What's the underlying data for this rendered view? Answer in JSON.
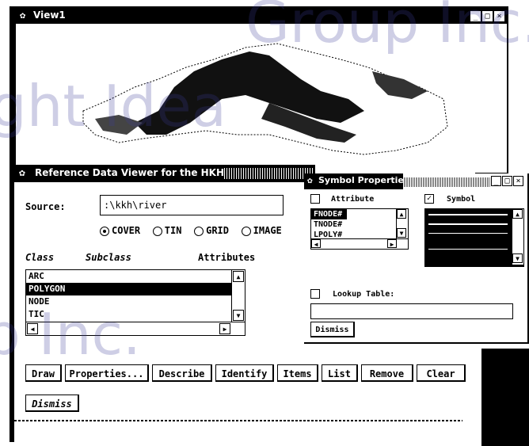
{
  "view_window": {
    "title": "View1",
    "minimize": "_",
    "maximize": "□",
    "close": "×"
  },
  "rdv": {
    "title": "Reference Data Viewer for the HKH",
    "source_label": "Source:",
    "source_value": ":\\kkh\\river",
    "radios": [
      {
        "label": "COVER",
        "selected": true
      },
      {
        "label": "TIN",
        "selected": false
      },
      {
        "label": "GRID",
        "selected": false
      },
      {
        "label": "IMAGE",
        "selected": false
      }
    ],
    "class_label": "Class",
    "subclass_label": "Subclass",
    "attributes_label": "Attributes",
    "class_items": [
      {
        "label": "ARC",
        "selected": false
      },
      {
        "label": "POLYGON",
        "selected": true
      },
      {
        "label": "NODE",
        "selected": false
      },
      {
        "label": "TIC",
        "selected": false
      }
    ],
    "buttons": [
      "Draw",
      "Properties...",
      "Describe",
      "Identify",
      "Items",
      "List",
      "Remove",
      "Clear"
    ],
    "dismiss_label": "Dismiss"
  },
  "symbol_props": {
    "title": "Symbol Properties",
    "attribute_label": "Attribute",
    "attribute_checked": false,
    "symbol_label": "Symbol",
    "symbol_checked": true,
    "attribute_items": [
      {
        "label": "FNODE#",
        "selected": true
      },
      {
        "label": "TNODE#",
        "selected": false
      },
      {
        "label": "LPOLY#",
        "selected": false
      }
    ],
    "lookup_label": "Lookup Table:",
    "lookup_checked": false,
    "lookup_value": "",
    "dismiss_label": "Dismiss"
  },
  "watermark": {
    "line1": "Group Inc.",
    "line2": "ght Idea",
    "line3": "p Inc."
  }
}
